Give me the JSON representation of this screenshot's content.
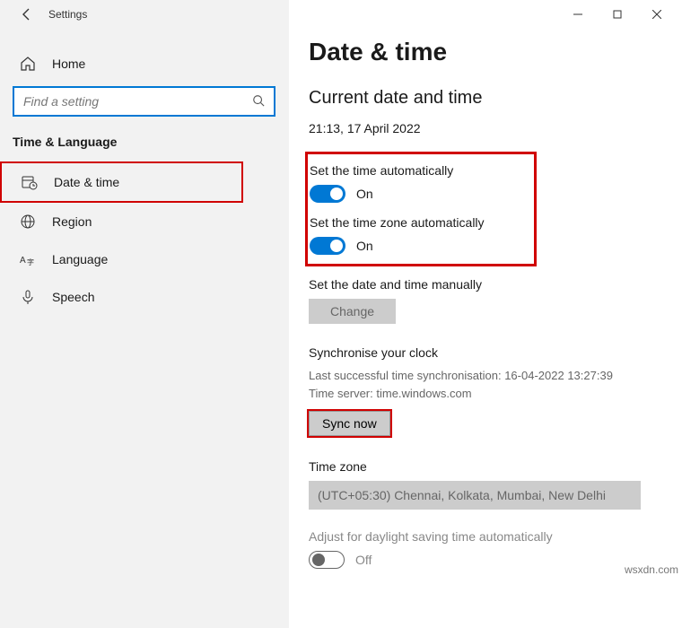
{
  "window": {
    "title": "Settings",
    "home_label": "Home",
    "search_placeholder": "Find a setting",
    "category": "Time & Language"
  },
  "nav": {
    "items": [
      {
        "label": "Date & time"
      },
      {
        "label": "Region"
      },
      {
        "label": "Language"
      },
      {
        "label": "Speech"
      }
    ]
  },
  "page": {
    "title": "Date & time",
    "current_section": "Current date and time",
    "current_value": "21:13, 17 April 2022",
    "auto_time_label": "Set the time automatically",
    "auto_time_state": "On",
    "auto_tz_label": "Set the time zone automatically",
    "auto_tz_state": "On",
    "manual_label": "Set the date and time manually",
    "change_btn": "Change",
    "sync_heading": "Synchronise your clock",
    "sync_last": "Last successful time synchronisation: 16-04-2022 13:27:39",
    "sync_server": "Time server: time.windows.com",
    "sync_btn": "Sync now",
    "tz_heading": "Time zone",
    "tz_value": "(UTC+05:30) Chennai, Kolkata, Mumbai, New Delhi",
    "dst_label": "Adjust for daylight saving time automatically",
    "dst_state": "Off"
  },
  "watermark": "wsxdn.com"
}
